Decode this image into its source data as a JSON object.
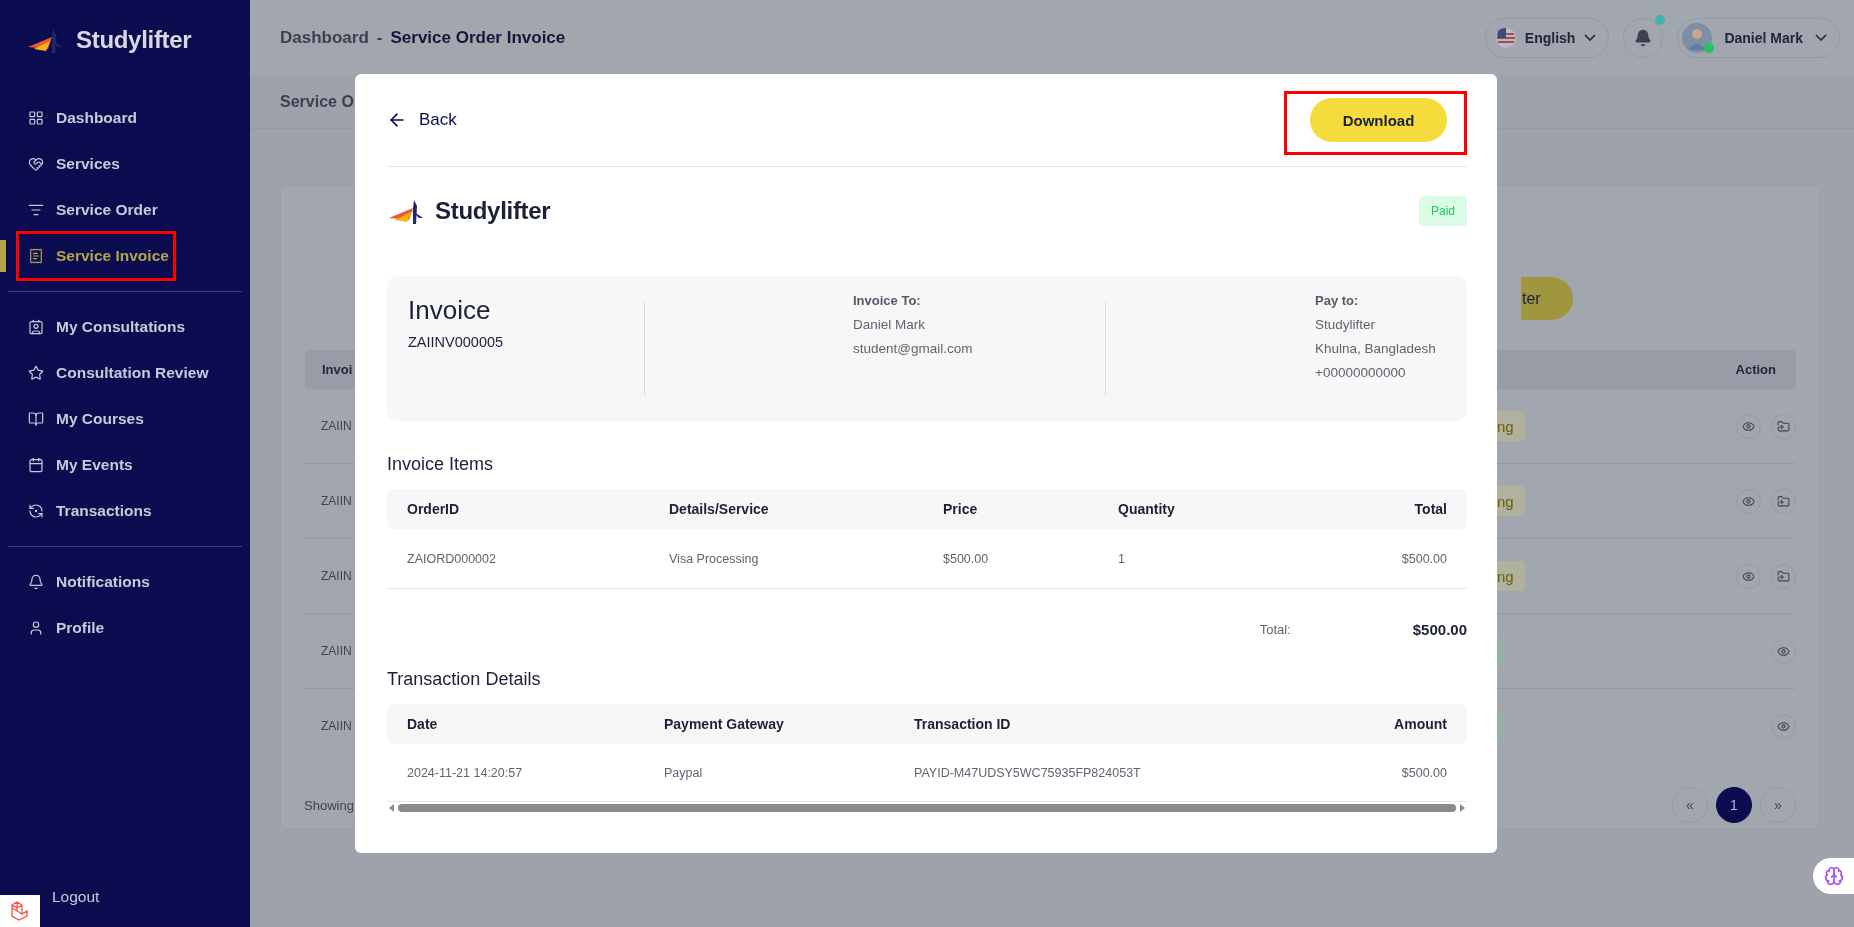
{
  "sidebar": {
    "brand": "Studylifter",
    "sections": [
      {
        "items": [
          {
            "label": "Dashboard",
            "selected": false,
            "annotated": false
          },
          {
            "label": "Services",
            "selected": false,
            "annotated": false
          },
          {
            "label": "Service Order",
            "selected": false,
            "annotated": false
          },
          {
            "label": "Service Invoice",
            "selected": true,
            "annotated": true
          }
        ]
      },
      {
        "items": [
          {
            "label": "My Consultations",
            "selected": false,
            "annotated": false
          },
          {
            "label": "Consultation Review",
            "selected": false,
            "annotated": false
          },
          {
            "label": "My Courses",
            "selected": false,
            "annotated": false
          },
          {
            "label": "My Events",
            "selected": false,
            "annotated": false
          },
          {
            "label": "Transactions",
            "selected": false,
            "annotated": false
          }
        ]
      },
      {
        "items": [
          {
            "label": "Notifications",
            "selected": false,
            "annotated": false
          },
          {
            "label": "Profile",
            "selected": false,
            "annotated": false
          }
        ]
      }
    ],
    "logout": "Logout"
  },
  "header": {
    "breadcrumb": "Dashboard",
    "separator": "-",
    "title": "Service Order Invoice",
    "language": "English",
    "has_unread": true,
    "user": "Daniel Mark",
    "online": true
  },
  "background": {
    "page_title": "Service O",
    "filter_button": "ter",
    "table": {
      "columns": [
        "Invoi",
        "Action"
      ],
      "rows": [
        {
          "column_1": "ZAIIN",
          "status": {
            "kind": "pending",
            "text": "ng"
          },
          "transferable": true
        },
        {
          "column_1": "ZAIIN",
          "status": {
            "kind": "pending",
            "text": "ng"
          },
          "transferable": true
        },
        {
          "column_1": "ZAIIN",
          "status": {
            "kind": "pending",
            "text": "ng"
          },
          "transferable": true
        },
        {
          "column_1": "ZAIIN",
          "status": {
            "kind": "paid"
          },
          "transferable": false
        },
        {
          "column_1": "ZAIIN",
          "status": {
            "kind": "paid"
          },
          "transferable": false
        }
      ]
    },
    "showing": "Showing",
    "pagination": {
      "prev": "«",
      "pages": [
        {
          "label": "1",
          "selected": true
        }
      ],
      "next": "»"
    }
  },
  "modal": {
    "back": "Back",
    "download": {
      "label": "Download",
      "annotated": true
    },
    "brand": "Studylifter",
    "status": {
      "kind": "paid",
      "text": "Paid"
    },
    "invoice": {
      "title": "Invoice",
      "number": "ZAIINV000005",
      "invoice_to": {
        "heading": "Invoice To:",
        "lines": [
          "Daniel Mark",
          "student@gmail.com"
        ]
      },
      "pay_to": {
        "heading": "Pay to:",
        "lines": [
          "Studylifter",
          "Khulna, Bangladesh",
          "+00000000000"
        ]
      }
    },
    "items": {
      "title": "Invoice Items",
      "columns": [
        "OrderID",
        "Details/Service",
        "Price",
        "Quantity",
        "Total"
      ],
      "rows": [
        [
          "ZAIORD000002",
          "Visa Processing",
          "$500.00",
          "1",
          "$500.00"
        ]
      ]
    },
    "total": {
      "label": "Total:",
      "value": "$500.00"
    },
    "transactions": {
      "title": "Transaction Details",
      "columns": [
        "Date",
        "Payment Gateway",
        "Transaction ID",
        "Amount"
      ],
      "rows": [
        [
          "2024-11-21 14:20:57",
          "Paypal",
          "PAYID-M47UDSY5WC75935FP824053T",
          "$500.00"
        ]
      ]
    }
  }
}
